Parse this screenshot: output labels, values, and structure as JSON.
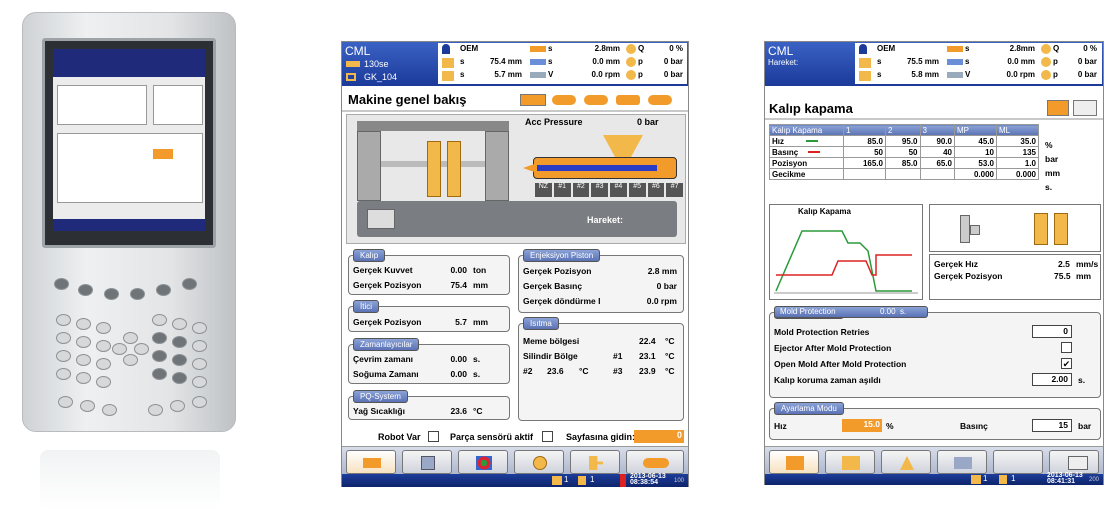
{
  "screen1": {
    "app": "CML",
    "machine": "130se",
    "mold": "GK_104",
    "hdr": {
      "r1": [
        "OEM",
        "s",
        "2.8mm",
        "Q",
        "0 %"
      ],
      "r2": [
        "s",
        "75.4 mm",
        "s",
        "0.0 mm",
        "p",
        "0 bar"
      ],
      "r3": [
        "s",
        "5.7 mm",
        "V",
        "0.0 rpm",
        "p",
        "0 bar"
      ]
    },
    "title": "Makine genel bakış",
    "acc_label": "Acc Pressure",
    "acc_value": "0 bar",
    "zones": [
      "NZ",
      "#1",
      "#2",
      "#3",
      "#4",
      "#5",
      "#6",
      "#7"
    ],
    "hareket": "Hareket:",
    "kalip": {
      "label": "Kalıp",
      "rows": [
        [
          "Gerçek Kuvvet",
          "0.00",
          "ton"
        ],
        [
          "Gerçek Pozisyon",
          "75.4",
          "mm"
        ]
      ]
    },
    "itici": {
      "label": "İtici",
      "rows": [
        [
          "Gerçek Pozisyon",
          "5.7",
          "mm"
        ]
      ]
    },
    "zaman": {
      "label": "Zamanlayıcılar",
      "rows": [
        [
          "Çevrim zamanı",
          "0.00",
          "s."
        ],
        [
          "Soğuma Zamanı",
          "0.00",
          "s."
        ]
      ]
    },
    "pq": {
      "label": "PQ-System",
      "rows": [
        [
          "Yağ Sıcaklığı",
          "23.6",
          "°C"
        ]
      ]
    },
    "enj": {
      "label": "Enjeksiyon Piston",
      "rows": [
        [
          "Gerçek Pozisyon",
          "2.8 mm"
        ],
        [
          "Gerçek Basınç",
          "0 bar"
        ],
        [
          "Gerçek döndürme I",
          "0.0 rpm"
        ]
      ]
    },
    "isitma": {
      "label": "Isıtma",
      "meme": [
        "Meme bölgesi",
        "22.4",
        "°C"
      ],
      "silindir": [
        "Silindir Bölge",
        "#1",
        "23.1",
        "°C"
      ],
      "z2": [
        "#2",
        "23.6",
        "°C",
        "#3",
        "23.9",
        "°C"
      ]
    },
    "robot": "Robot Var",
    "parca": "Parça sensörü aktif",
    "sayfa": "Sayfasına gidin:",
    "sayfa_value": "0",
    "date": "2013-06-13",
    "time": "08:38:54",
    "status_nums": [
      "1",
      "1"
    ],
    "corner": "100"
  },
  "screen2": {
    "app": "CML",
    "sub": "Hareket:",
    "hdr": {
      "r1": [
        "OEM",
        "s",
        "2.8mm",
        "Q",
        "0 %"
      ],
      "r2": [
        "s",
        "75.5 mm",
        "s",
        "0.0 mm",
        "p",
        "0 bar"
      ],
      "r3": [
        "s",
        "5.8 mm",
        "V",
        "0.0 rpm",
        "p",
        "0 bar"
      ]
    },
    "title": "Kalıp kapama",
    "table": {
      "head": [
        "Kalıp Kapama",
        "1",
        "2",
        "3",
        "MP",
        "ML"
      ],
      "rows": [
        [
          "Hız",
          "85.0",
          "95.0",
          "90.0",
          "45.0",
          "35.0",
          "%"
        ],
        [
          "Basınç",
          "50",
          "50",
          "40",
          "10",
          "135",
          "bar"
        ],
        [
          "Pozisyon",
          "165.0",
          "85.0",
          "65.0",
          "53.0",
          "1.0",
          "mm"
        ],
        [
          "Gecikme",
          "",
          "",
          "",
          "0.000",
          "0.000",
          "s."
        ]
      ]
    },
    "graph_title": "Kalıp Kapama",
    "gercek_hiz": [
      "Gerçek Hız",
      "2.5",
      "mm/s"
    ],
    "gercek_poz": [
      "Gerçek Pozisyon",
      "75.5",
      "mm"
    ],
    "mold_prot": {
      "label": "Mold Protection",
      "value": "0.00",
      "unit": "s."
    },
    "mp_rows": [
      {
        "label": "Mold Protection Retries",
        "value": "0"
      },
      {
        "label": "Ejector After Mold Protection",
        "value": ""
      },
      {
        "label": "Open Mold After Mold Protection",
        "value": "✔"
      },
      {
        "label": "Kalıp koruma zaman aşıldı",
        "value": "2.00",
        "unit": "s."
      }
    ],
    "ayar": {
      "label": "Ayarlama Modu",
      "hiz": "Hız",
      "hiz_val": "15.0",
      "hiz_unit": "%",
      "basinc": "Basınç",
      "basinc_val": "15",
      "basinc_unit": "bar"
    },
    "date": "2013-06-13",
    "time": "08:41:31",
    "status_nums": [
      "1",
      "1"
    ],
    "corner": "200"
  }
}
